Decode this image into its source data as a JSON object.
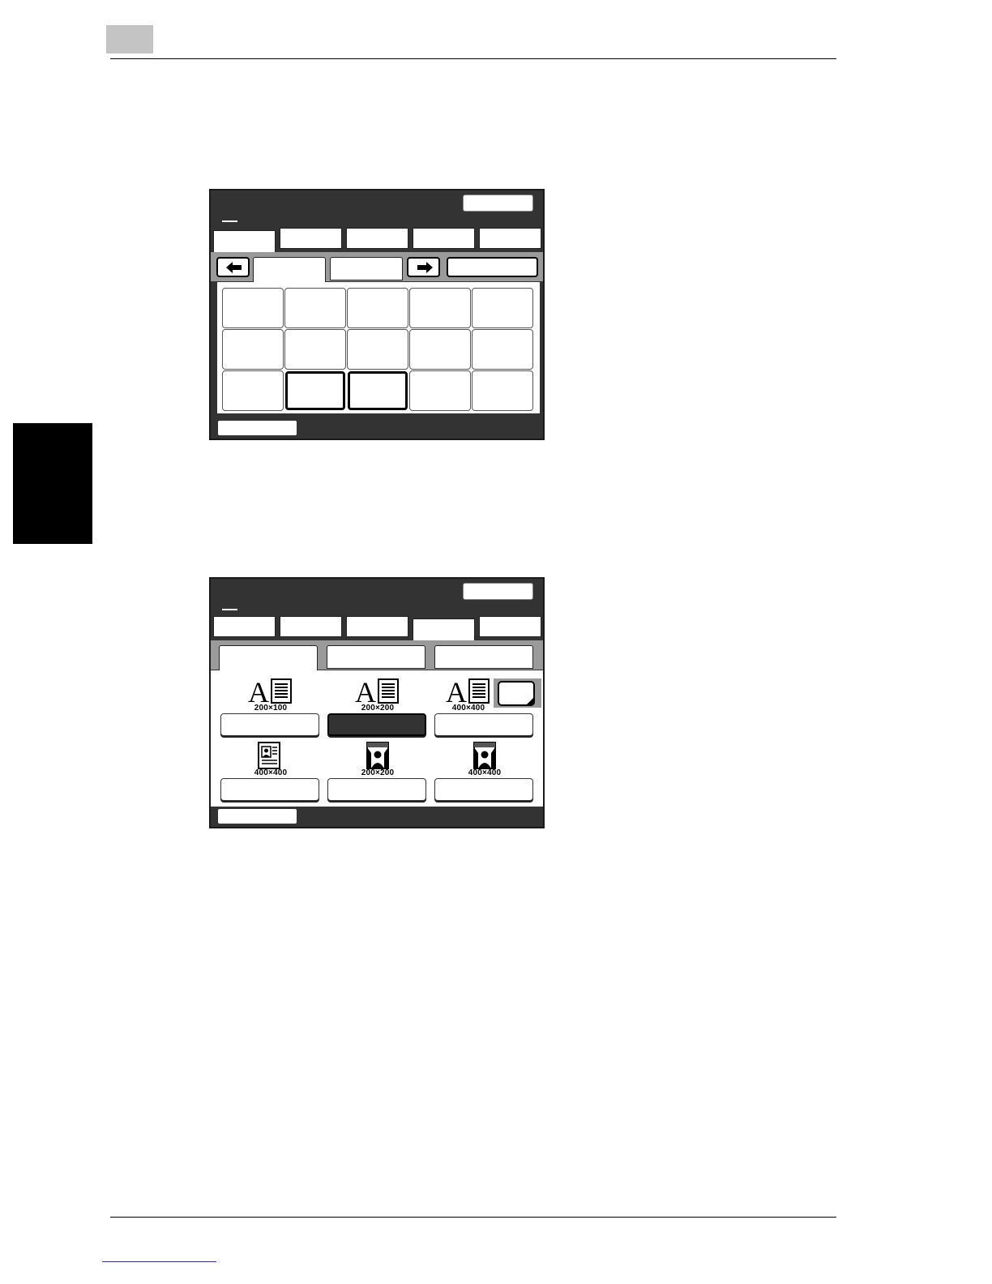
{
  "panel2": {
    "resolutions": [
      {
        "label": "200×100",
        "selected": false
      },
      {
        "label": "200×200",
        "selected": true
      },
      {
        "label": "400×400",
        "selected": false
      },
      {
        "label": "400×400",
        "selected": false
      },
      {
        "label": "200×200",
        "selected": false
      },
      {
        "label": "400×400",
        "selected": false
      }
    ]
  },
  "icons": {
    "left_arrow": "arrow-left-icon",
    "right_arrow": "arrow-right-icon",
    "text_doc": "text-document-icon",
    "photo_doc": "photo-document-icon",
    "portrait": "portrait-icon"
  },
  "colors": {
    "panel_bg": "#333333",
    "band": "#9a9a9a",
    "side_tab": "#000000"
  }
}
